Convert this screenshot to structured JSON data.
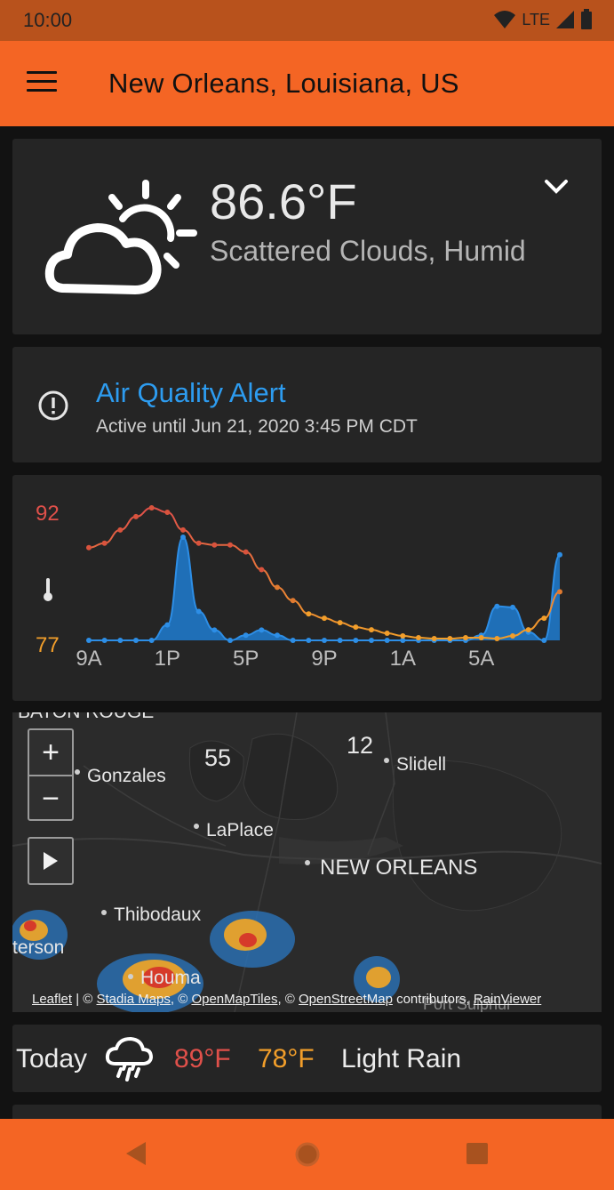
{
  "status_bar": {
    "time": "10:00",
    "network": "LTE",
    "icons": [
      "wifi-icon",
      "signal-icon",
      "battery-icon"
    ]
  },
  "app_bar": {
    "title": "New Orleans, Louisiana, US",
    "menu_icon": "menu-icon"
  },
  "current": {
    "temperature": "86.6°F",
    "condition": "Scattered Clouds, Humid",
    "icon": "partly-cloudy-icon",
    "expand_icon": "chevron-down-icon"
  },
  "alert": {
    "icon": "alert-circle-icon",
    "title": "Air Quality Alert",
    "subtitle": "Active until Jun 21, 2020 3:45 PM CDT"
  },
  "colors": {
    "accent": "#f46524",
    "high": "#e0504a",
    "low": "#f29e2a",
    "precip": "#2d8ee6",
    "alert": "#2d9cf0"
  },
  "chart_data": {
    "type": "line",
    "y_labels": {
      "max": "92",
      "min": "77"
    },
    "ylim": [
      77,
      92
    ],
    "x_tick_labels": [
      "9A",
      "1P",
      "5P",
      "9P",
      "1A",
      "5A"
    ],
    "series": [
      {
        "values": [
          87.5,
          88,
          89.5,
          91,
          92,
          91.5,
          89.5,
          88,
          87.8,
          87.8,
          87,
          85,
          83,
          81.5,
          80,
          79.5,
          79,
          78.5,
          78.2,
          77.8,
          77.5,
          77.3,
          77.2,
          77.2,
          77.3,
          77.3,
          77.2,
          77.5,
          78.2,
          79.5,
          82.5
        ]
      },
      {
        "values": [
          0,
          0,
          0,
          0,
          0,
          0.15,
          1.0,
          0.28,
          0.1,
          0,
          0.05,
          0.1,
          0.05,
          0,
          0,
          0,
          0,
          0,
          0,
          0,
          0,
          0,
          0,
          0,
          0,
          0.05,
          0.33,
          0.32,
          0.08,
          0,
          0.83
        ]
      }
    ]
  },
  "map": {
    "zoom_in": "+",
    "zoom_out": "−",
    "play_icon": "play-icon",
    "labels": {
      "baton_rouge": "BATON ROUGE",
      "gonzales": "Gonzales",
      "laplace": "LaPlace",
      "new_orleans": "NEW ORLEANS",
      "slidell": "Slidell",
      "thibodaux": "Thibodaux",
      "patterson": "terson",
      "houma": "Houma",
      "port_sulphur": "Port Sulphur",
      "hwy55": "55",
      "hwy12": "12"
    },
    "attribution": {
      "leaflet": "Leaflet",
      "stadia": "Stadia Maps",
      "openmaptiles": "OpenMapTiles",
      "osm": "OpenStreetMap",
      "contributors": "contributors,",
      "rainviewer": "RainViewer"
    }
  },
  "today": {
    "label": "Today",
    "icon": "rain-icon",
    "high": "89°F",
    "low": "78°F",
    "description": "Light Rain"
  },
  "nav": {
    "back_icon": "back-icon",
    "home_icon": "home-icon",
    "recents_icon": "recents-icon"
  }
}
